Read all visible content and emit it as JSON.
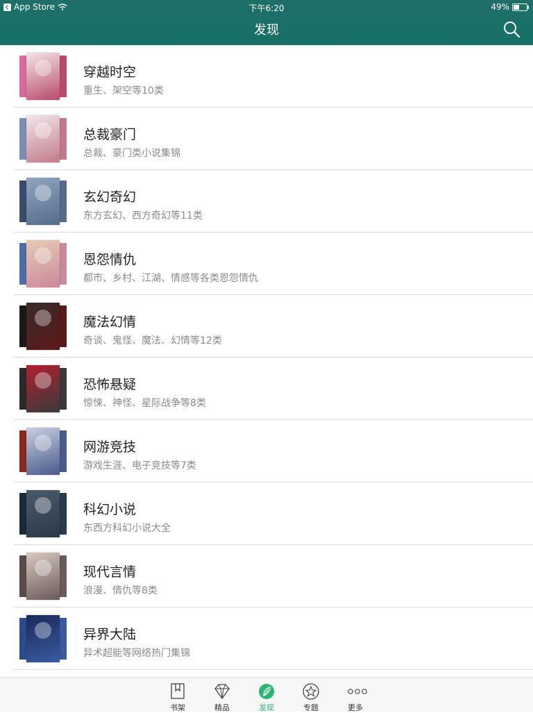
{
  "status_bar": {
    "back_app": "App Store",
    "time": "下午6:20",
    "battery": "49%",
    "battery_level": 0.49
  },
  "nav": {
    "title": "发现",
    "search_icon": "search-icon"
  },
  "colors": {
    "nav_bg": "#1d6e66",
    "active_tab": "#2bb673",
    "divider": "#d9d9d9",
    "subtitle": "#8a8a8a"
  },
  "categories": [
    {
      "title": "穿越时空",
      "subtitle": "重生、架空等10类",
      "cover_colors": [
        "#d96a9a",
        "#f3e6e8",
        "#b84a6a"
      ]
    },
    {
      "title": "总裁豪门",
      "subtitle": "总裁、豪门类小说集锦",
      "cover_colors": [
        "#7a8fb3",
        "#f0e6ea",
        "#c27a8a"
      ]
    },
    {
      "title": "玄幻奇幻",
      "subtitle": "东方玄幻、西方奇幻等11类",
      "cover_colors": [
        "#3a4a6a",
        "#8fa6c0",
        "#556b8a"
      ]
    },
    {
      "title": "恩怨情仇",
      "subtitle": "都市、乡村、江湖、情感等各类恩怨情仇",
      "cover_colors": [
        "#4a6fa8",
        "#e8c9b5",
        "#c98a9a"
      ]
    },
    {
      "title": "魔法幻情",
      "subtitle": "奇谈、鬼怪、魔法、幻情等12类",
      "cover_colors": [
        "#1a1a1a",
        "#3a2a2a",
        "#5a1a1a"
      ]
    },
    {
      "title": "恐怖悬疑",
      "subtitle": "惊悚、神怪、星际战争等8类",
      "cover_colors": [
        "#2a2a2a",
        "#b02030",
        "#3a3a3a"
      ]
    },
    {
      "title": "网游竞技",
      "subtitle": "游戏生涯、电子竞技等7类",
      "cover_colors": [
        "#8a2a1a",
        "#c8d0e0",
        "#4a5a8a"
      ]
    },
    {
      "title": "科幻小说",
      "subtitle": "东西方科幻小说大全",
      "cover_colors": [
        "#1a2a3a",
        "#4a5a6a",
        "#2a3a4a"
      ]
    },
    {
      "title": "现代言情",
      "subtitle": "浪漫、情仇等8类",
      "cover_colors": [
        "#5a4a4a",
        "#d8c8c0",
        "#6a5a5a"
      ]
    },
    {
      "title": "异界大陆",
      "subtitle": "异术超能等网络热门集锦",
      "cover_colors": [
        "#2a4a8a",
        "#1a2a5a",
        "#3a5aa0"
      ]
    }
  ],
  "tabs": [
    {
      "label": "书架",
      "icon": "bookmark-icon",
      "active": false
    },
    {
      "label": "精品",
      "icon": "diamond-icon",
      "active": false
    },
    {
      "label": "发现",
      "icon": "leaf-icon",
      "active": true
    },
    {
      "label": "专题",
      "icon": "star-circle-icon",
      "active": false
    },
    {
      "label": "更多",
      "icon": "more-dots-icon",
      "active": false
    }
  ]
}
